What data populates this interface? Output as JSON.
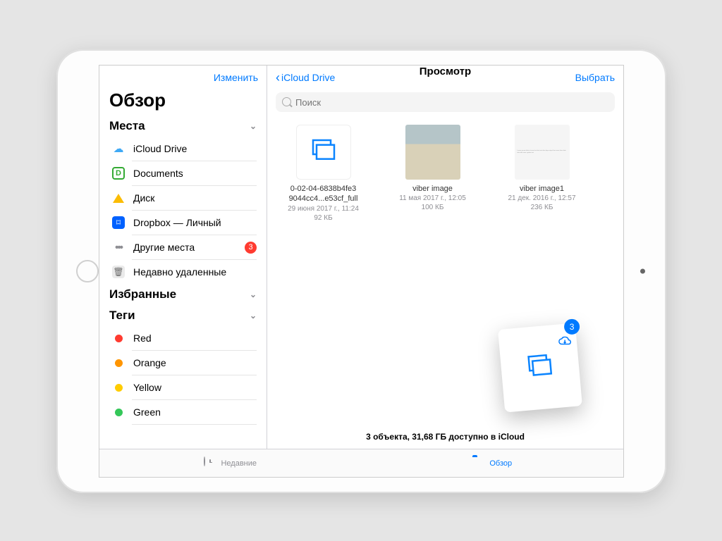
{
  "sidebar": {
    "edit": "Изменить",
    "title": "Обзор",
    "places_header": "Места",
    "locations": [
      {
        "label": "iCloud Drive"
      },
      {
        "label": "Documents"
      },
      {
        "label": "Диск"
      },
      {
        "label": "Dropbox — Личный"
      },
      {
        "label": "Другие места",
        "badge": "3"
      },
      {
        "label": "Недавно удаленные"
      }
    ],
    "favorites_header": "Избранные",
    "tags_header": "Теги",
    "tags": [
      {
        "label": "Red",
        "color": "#ff3b30"
      },
      {
        "label": "Orange",
        "color": "#ff9500"
      },
      {
        "label": "Yellow",
        "color": "#ffcc00"
      },
      {
        "label": "Green",
        "color": "#34c759"
      }
    ]
  },
  "main": {
    "back_label": "iCloud Drive",
    "title": "Просмотр",
    "select": "Выбрать",
    "search_placeholder": "Поиск",
    "files": [
      {
        "name_l1": "0-02-04-6838b4fe3",
        "name_l2": "9044cc4...e53cf_full",
        "date": "29 июня 2017 г., 11:24",
        "size": "92 КБ"
      },
      {
        "name_l1": "viber image",
        "name_l2": "",
        "date": "11 мая 2017 г., 12:05",
        "size": "100 КБ"
      },
      {
        "name_l1": "viber image1",
        "name_l2": "",
        "date": "21 дек. 2016 г., 12:57",
        "size": "236 КБ"
      }
    ],
    "floating_badge": "3",
    "status": "3 объекта, 31,68 ГБ доступно в iCloud"
  },
  "tabbar": {
    "recents": "Недавние",
    "browse": "Обзор"
  }
}
